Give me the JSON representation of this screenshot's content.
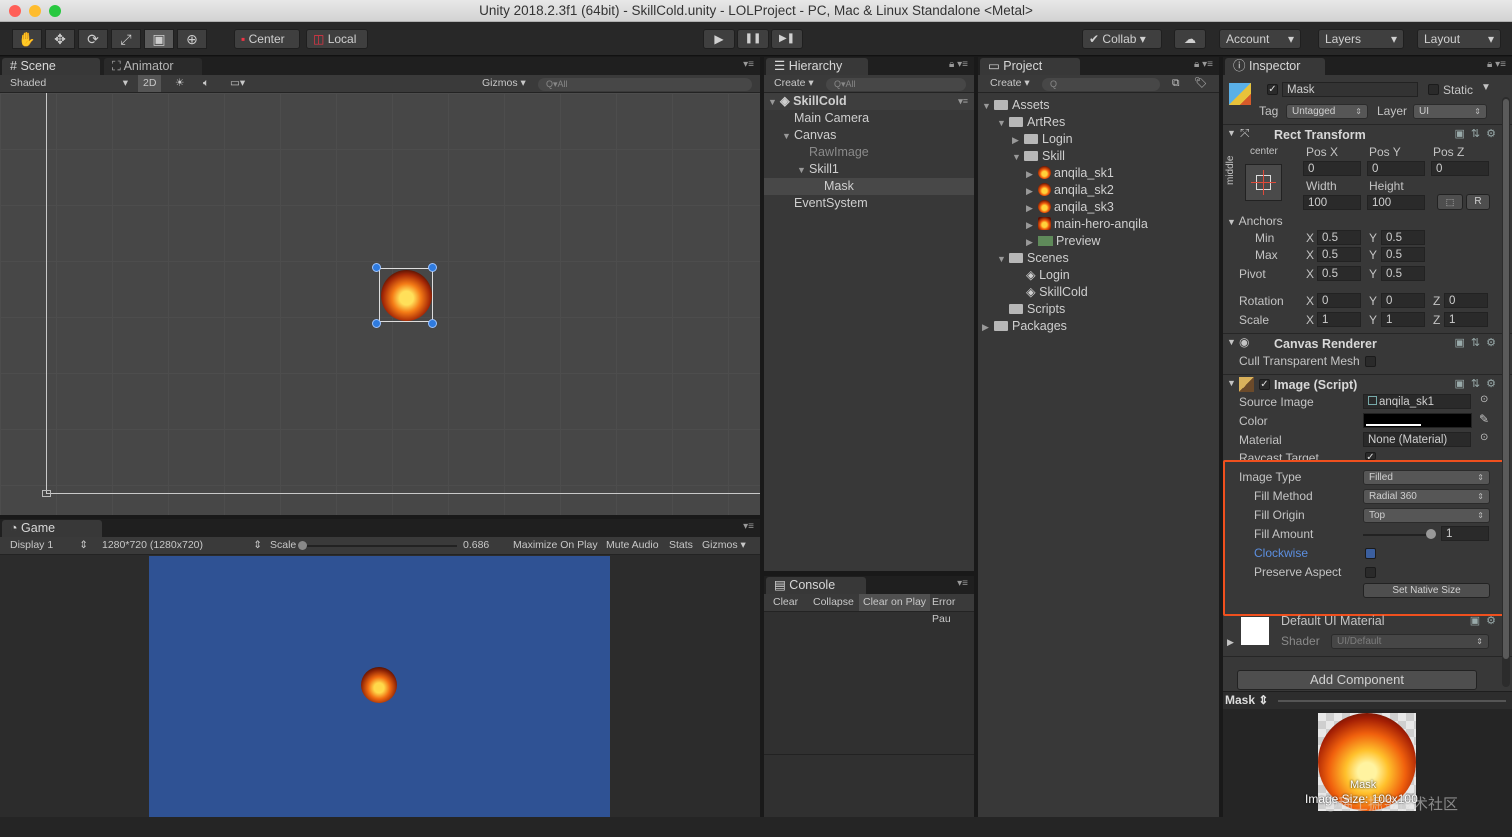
{
  "window": {
    "title": "Unity 2018.2.3f1 (64bit) - SkillCold.unity - LOLProject - PC, Mac & Linux Standalone <Metal>",
    "traffic_colors": [
      "#ff5f57",
      "#febc2e",
      "#28c840"
    ]
  },
  "toolbar": {
    "tools": [
      "hand-tool",
      "move-tool",
      "rotate-tool",
      "scale-tool",
      "rect-tool",
      "transform-tool"
    ],
    "pivot_mode": "Center",
    "pivot_rotation": "Local",
    "play_icon": "▶",
    "pause_icon": "❚❚",
    "step_icon": "▶❚",
    "collab": "Collab",
    "account": "Account",
    "layers": "Layers",
    "layout": "Layout"
  },
  "scene_panel": {
    "tabs": [
      "Scene",
      "Animator"
    ],
    "shading": "Shaded",
    "mode_2d": "2D",
    "gizmos": "Gizmos",
    "search_placeholder": "Q▾All"
  },
  "game_panel": {
    "tab": "Game",
    "display": "Display 1",
    "resolution": "1280*720 (1280x720)",
    "scale_label": "Scale",
    "scale_value": "0.686",
    "options": [
      "Maximize On Play",
      "Mute Audio",
      "Stats",
      "Gizmos"
    ],
    "game_bg": "#2f5294"
  },
  "hierarchy": {
    "tab": "Hierarchy",
    "create": "Create",
    "search_placeholder": "Q▾All",
    "scene": "SkillCold",
    "items": [
      {
        "label": "Main Camera",
        "dim": false
      },
      {
        "label": "Canvas",
        "dim": false
      },
      {
        "label": "RawImage",
        "dim": true
      },
      {
        "label": "Skill1",
        "dim": false
      },
      {
        "label": "Mask",
        "dim": false
      },
      {
        "label": "EventSystem",
        "dim": false
      }
    ]
  },
  "console": {
    "tab": "Console",
    "buttons": [
      "Clear",
      "Collapse",
      "Clear on Play",
      "Error Pau"
    ]
  },
  "project": {
    "tab": "Project",
    "create": "Create",
    "items": [
      "Assets",
      "ArtRes",
      "Login",
      "Skill",
      "anqila_sk1",
      "anqila_sk2",
      "anqila_sk3",
      "main-hero-anqila",
      "Preview",
      "Scenes",
      "Login",
      "SkillCold",
      "Scripts",
      "Packages"
    ]
  },
  "inspector": {
    "tab": "Inspector",
    "object_name": "Mask",
    "static_label": "Static",
    "tag_label": "Tag",
    "tag_value": "Untagged",
    "layer_label": "Layer",
    "layer_value": "UI",
    "rect_transform": {
      "title": "Rect Transform",
      "anchor_h": "center",
      "anchor_v": "middle",
      "pos_labels": [
        "Pos X",
        "Pos Y",
        "Pos Z"
      ],
      "pos_values": [
        "0",
        "0",
        "0"
      ],
      "width_label": "Width",
      "height_label": "Height",
      "width": "100",
      "height": "100",
      "r_button": "R",
      "anchors_label": "Anchors",
      "min_label": "Min",
      "max_label": "Max",
      "pivot_label": "Pivot",
      "min": [
        "0.5",
        "0.5"
      ],
      "max": [
        "0.5",
        "0.5"
      ],
      "pivot": [
        "0.5",
        "0.5"
      ],
      "rotation_label": "Rotation",
      "rotation": [
        "0",
        "0",
        "0"
      ],
      "scale_label": "Scale",
      "scale": [
        "1",
        "1",
        "1"
      ],
      "x": "X",
      "y": "Y",
      "z": "Z"
    },
    "canvas_renderer": {
      "title": "Canvas Renderer",
      "cull_label": "Cull Transparent Mesh"
    },
    "image_script": {
      "title": "Image (Script)",
      "source_image_label": "Source Image",
      "source_image": "anqila_sk1",
      "color_label": "Color",
      "material_label": "Material",
      "material": "None (Material)",
      "raycast_label": "Raycast Target",
      "image_type_label": "Image Type",
      "image_type": "Filled",
      "fill_method_label": "Fill Method",
      "fill_method": "Radial 360",
      "fill_origin_label": "Fill Origin",
      "fill_origin": "Top",
      "fill_amount_label": "Fill Amount",
      "fill_amount": "1",
      "clockwise_label": "Clockwise",
      "preserve_label": "Preserve Aspect",
      "set_native": "Set Native Size",
      "highlight_color": "#f0501e"
    },
    "material_block": {
      "title": "Default UI Material",
      "shader_label": "Shader",
      "shader": "UI/Default"
    },
    "add_component": "Add Component",
    "preview_title": "Mask",
    "preview_caption": "Mask",
    "preview_size": "Image Size: 100x100",
    "watermark": "@稀土掘金技术社区"
  }
}
